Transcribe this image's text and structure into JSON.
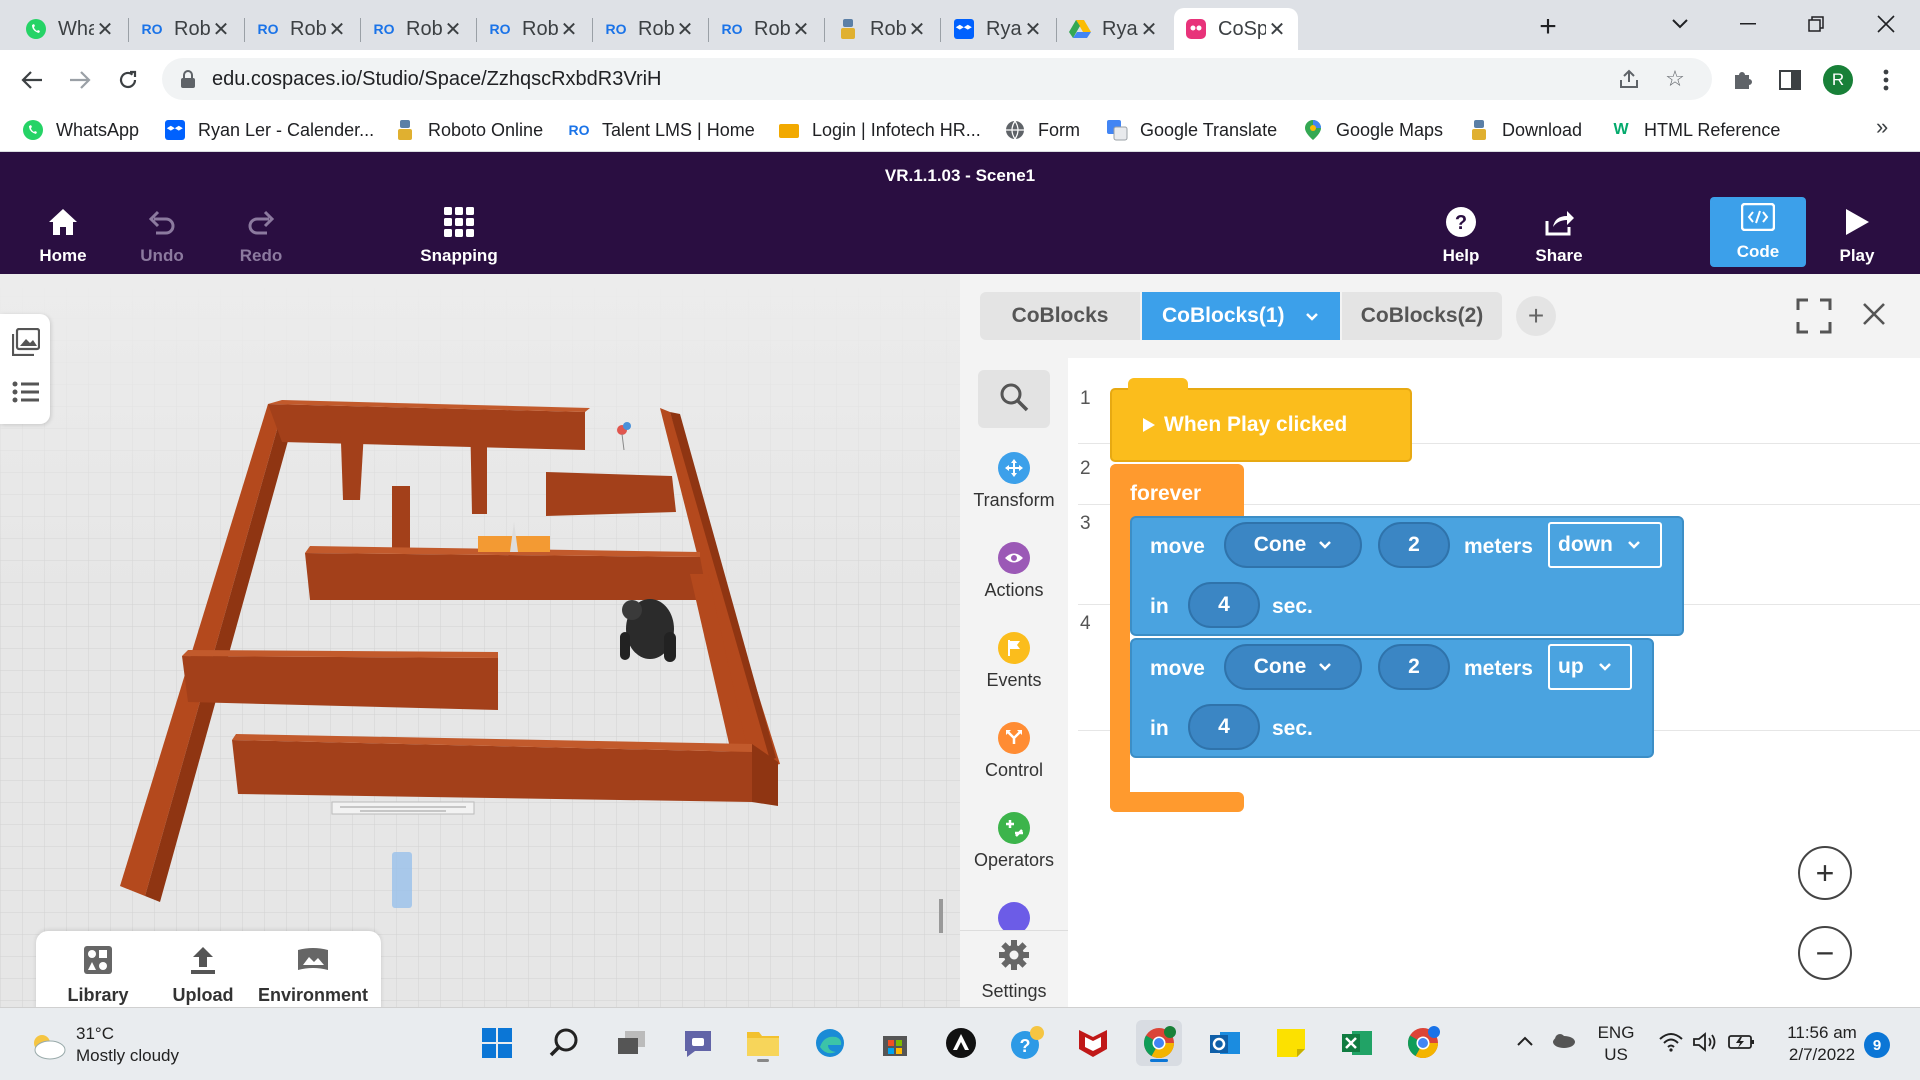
{
  "browser": {
    "tabs": [
      {
        "title": "What",
        "icon": "whatsapp-icon"
      },
      {
        "title": "Robo",
        "icon": "roboto-icon"
      },
      {
        "title": "Robo",
        "icon": "roboto-icon"
      },
      {
        "title": "Robo",
        "icon": "roboto-icon"
      },
      {
        "title": "Robo",
        "icon": "roboto-icon"
      },
      {
        "title": "Robo",
        "icon": "roboto-icon"
      },
      {
        "title": "Robo",
        "icon": "roboto-icon"
      },
      {
        "title": "Robo",
        "icon": "robot-icon"
      },
      {
        "title": "Ryan",
        "icon": "dropbox-icon"
      },
      {
        "title": "Ryan",
        "icon": "drive-icon"
      },
      {
        "title": "CoSp",
        "icon": "cospaces-icon",
        "active": true
      }
    ],
    "favicon_text": "RO",
    "url": "edu.cospaces.io/Studio/Space/ZzhqscRxbdR3VriH",
    "profile_initial": "R",
    "bookmarks": [
      {
        "label": "WhatsApp",
        "icon": "whatsapp-icon"
      },
      {
        "label": "Ryan Ler - Calender...",
        "icon": "dropbox-icon"
      },
      {
        "label": "Roboto Online",
        "icon": "robot-icon"
      },
      {
        "label": "Talent LMS | Home",
        "icon": "roboto-icon"
      },
      {
        "label": "Login | Infotech HR...",
        "icon": "infotech-icon"
      },
      {
        "label": "Form",
        "icon": "globe-icon"
      },
      {
        "label": "Google Translate",
        "icon": "translate-icon"
      },
      {
        "label": "Google Maps",
        "icon": "maps-icon"
      },
      {
        "label": "Download",
        "icon": "robot-icon"
      },
      {
        "label": "HTML Reference",
        "icon": "w3schools-icon"
      }
    ],
    "bookmarks_more": "»"
  },
  "app": {
    "scene_title": "VR.1.1.03 - Scene1",
    "header_buttons": {
      "home": "Home",
      "undo": "Undo",
      "redo": "Redo",
      "snapping": "Snapping",
      "help": "Help",
      "share": "Share",
      "code": "Code",
      "play": "Play"
    },
    "bottom_tools": {
      "library": "Library",
      "upload": "Upload",
      "environment": "Environment"
    }
  },
  "code_panel": {
    "tabs": [
      {
        "label": "CoBlocks",
        "active": false
      },
      {
        "label": "CoBlocks(1)",
        "active": true
      },
      {
        "label": "CoBlocks(2)",
        "active": false
      }
    ],
    "add_tab": "+",
    "categories": [
      {
        "label": "Transform",
        "color": "#3ca0ea",
        "icon": "transform-icon"
      },
      {
        "label": "Actions",
        "color": "#9b59b6",
        "icon": "eye-icon"
      },
      {
        "label": "Events",
        "color": "#fbbd1c",
        "icon": "flag-icon"
      },
      {
        "label": "Control",
        "color": "#ff8c33",
        "icon": "control-icon"
      },
      {
        "label": "Operators",
        "color": "#3cb44b",
        "icon": "operators-icon"
      }
    ],
    "settings_label": "Settings",
    "line_numbers": [
      "1",
      "2",
      "3",
      "4"
    ],
    "blocks": {
      "event": "When Play clicked",
      "loop": "forever",
      "moves": [
        {
          "verb": "move",
          "object": "Cone",
          "distance": "2",
          "unit": "meters",
          "direction": "down",
          "in": "in",
          "duration": "4",
          "sec": "sec."
        },
        {
          "verb": "move",
          "object": "Cone",
          "distance": "2",
          "unit": "meters",
          "direction": "up",
          "in": "in",
          "duration": "4",
          "sec": "sec."
        }
      ]
    },
    "zoom_in": "+",
    "zoom_out": "−"
  },
  "taskbar": {
    "weather_temp": "31°C",
    "weather_desc": "Mostly cloudy",
    "lang_1": "ENG",
    "lang_2": "US",
    "time": "11:56 am",
    "date": "2/7/2022",
    "notification_count": "9"
  }
}
